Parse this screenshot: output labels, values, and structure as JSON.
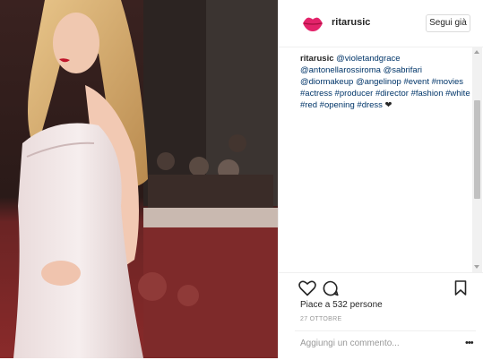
{
  "post": {
    "username": "ritarusic",
    "follow_label": "Segui già",
    "caption": {
      "user": "ritarusic",
      "parts": [
        {
          "t": " "
        },
        {
          "t": "@violetandgrace",
          "tag": true
        },
        {
          "t": " "
        },
        {
          "t": "@antonellarossiroma",
          "tag": true
        },
        {
          "t": " "
        },
        {
          "t": "@sabrifari",
          "tag": true
        },
        {
          "t": " "
        },
        {
          "t": "@diormakeup",
          "tag": true
        },
        {
          "t": " "
        },
        {
          "t": "@angelinop",
          "tag": true
        },
        {
          "t": " "
        },
        {
          "t": "#event",
          "tag": true
        },
        {
          "t": " "
        },
        {
          "t": "#movies",
          "tag": true
        },
        {
          "t": " "
        },
        {
          "t": "#actress",
          "tag": true
        },
        {
          "t": " "
        },
        {
          "t": "#producer",
          "tag": true
        },
        {
          "t": " "
        },
        {
          "t": "#director",
          "tag": true
        },
        {
          "t": " "
        },
        {
          "t": "#fashion",
          "tag": true
        },
        {
          "t": " "
        },
        {
          "t": "#white",
          "tag": true
        },
        {
          "t": " "
        },
        {
          "t": "#red",
          "tag": true
        },
        {
          "t": " "
        },
        {
          "t": "#opening",
          "tag": true
        },
        {
          "t": " "
        },
        {
          "t": "#dress",
          "tag": true
        },
        {
          "t": " ❤"
        }
      ]
    },
    "likes": "Piace a 532 persone",
    "date": "27 OTTOBRE",
    "comment_placeholder": "Aggiungi un commento...",
    "more_label": "•••"
  },
  "icons": {
    "avatar": "lips-avatar-icon",
    "like": "heart-icon",
    "comment": "comment-bubble-icon",
    "save": "bookmark-icon",
    "more": "more-options-icon"
  },
  "colors": {
    "avatar": "#e3236a",
    "hashtag": "#003569",
    "text": "#262626",
    "muted": "#999999"
  }
}
